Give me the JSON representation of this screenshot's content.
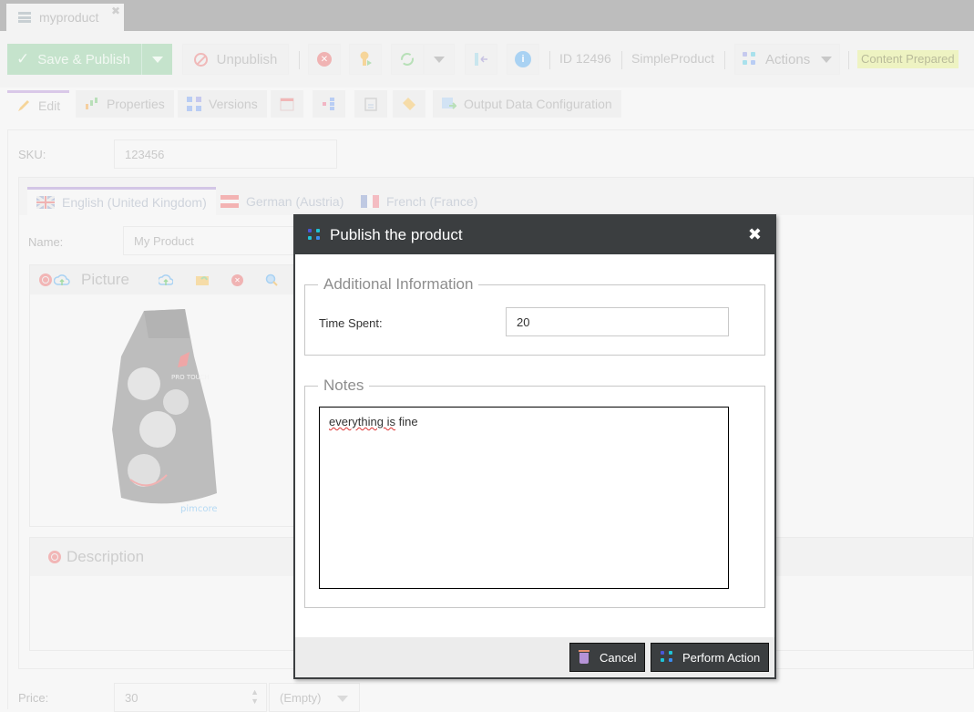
{
  "document_tab": {
    "label": "myproduct",
    "close_icon": "close-icon"
  },
  "toolbar": {
    "save_publish_label": "Save & Publish",
    "unpublish_label": "Unpublish",
    "object_id": "ID 12496",
    "object_class": "SimpleProduct",
    "actions_label": "Actions",
    "status_badge": "Content Prepared",
    "icons": [
      "delete-icon",
      "key-icon",
      "reload-icon",
      "reveal-in-tree-icon",
      "info-icon"
    ]
  },
  "subtabs": {
    "edit": "Edit",
    "properties": "Properties",
    "versions": "Versions",
    "output_data": "Output Data Configuration"
  },
  "form": {
    "sku_label": "SKU:",
    "sku_value": "123456",
    "languages": [
      "English (United Kingdom)",
      "German (Austria)",
      "French (France)"
    ],
    "name_label": "Name:",
    "name_value": "My Product",
    "picture_label": "Picture",
    "picture_watermark": "pimcore",
    "description_label": "Description",
    "price_label": "Price:",
    "price_value": "30",
    "unit_value": "(Empty)"
  },
  "modal": {
    "title": "Publish the product",
    "fieldset_info": "Additional Information",
    "time_spent_label": "Time Spent:",
    "time_spent_value": "20",
    "fieldset_notes": "Notes",
    "notes_value_misspelled": "everything is",
    "notes_value_rest": " fine",
    "cancel_label": "Cancel",
    "perform_label": "Perform Action"
  },
  "colors": {
    "save_button": "#c5e3cc",
    "modal_header": "#3b3e40",
    "status_badge_bg": "#eef3c2",
    "active_tab_accent": "#d9c8e8"
  }
}
